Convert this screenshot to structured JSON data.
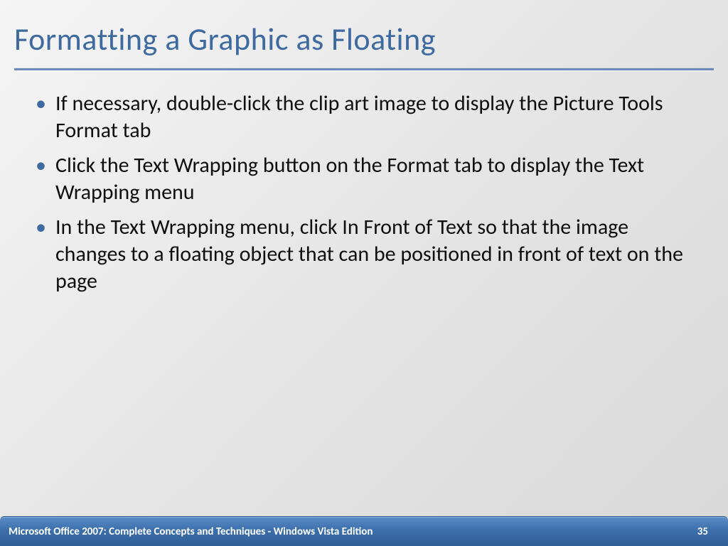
{
  "slide": {
    "title": "Formatting a Graphic as Floating",
    "bullets": [
      "If necessary, double-click the clip art image to display the Picture Tools Format tab",
      "Click the Text Wrapping button on the Format tab to display the Text Wrapping menu",
      "In the Text Wrapping menu, click In Front of Text so that the image changes to a floating object that can be positioned in front of text on the page"
    ]
  },
  "footer": {
    "text": "Microsoft Office 2007: Complete Concepts and Techniques - Windows Vista Edition",
    "page": "35"
  }
}
